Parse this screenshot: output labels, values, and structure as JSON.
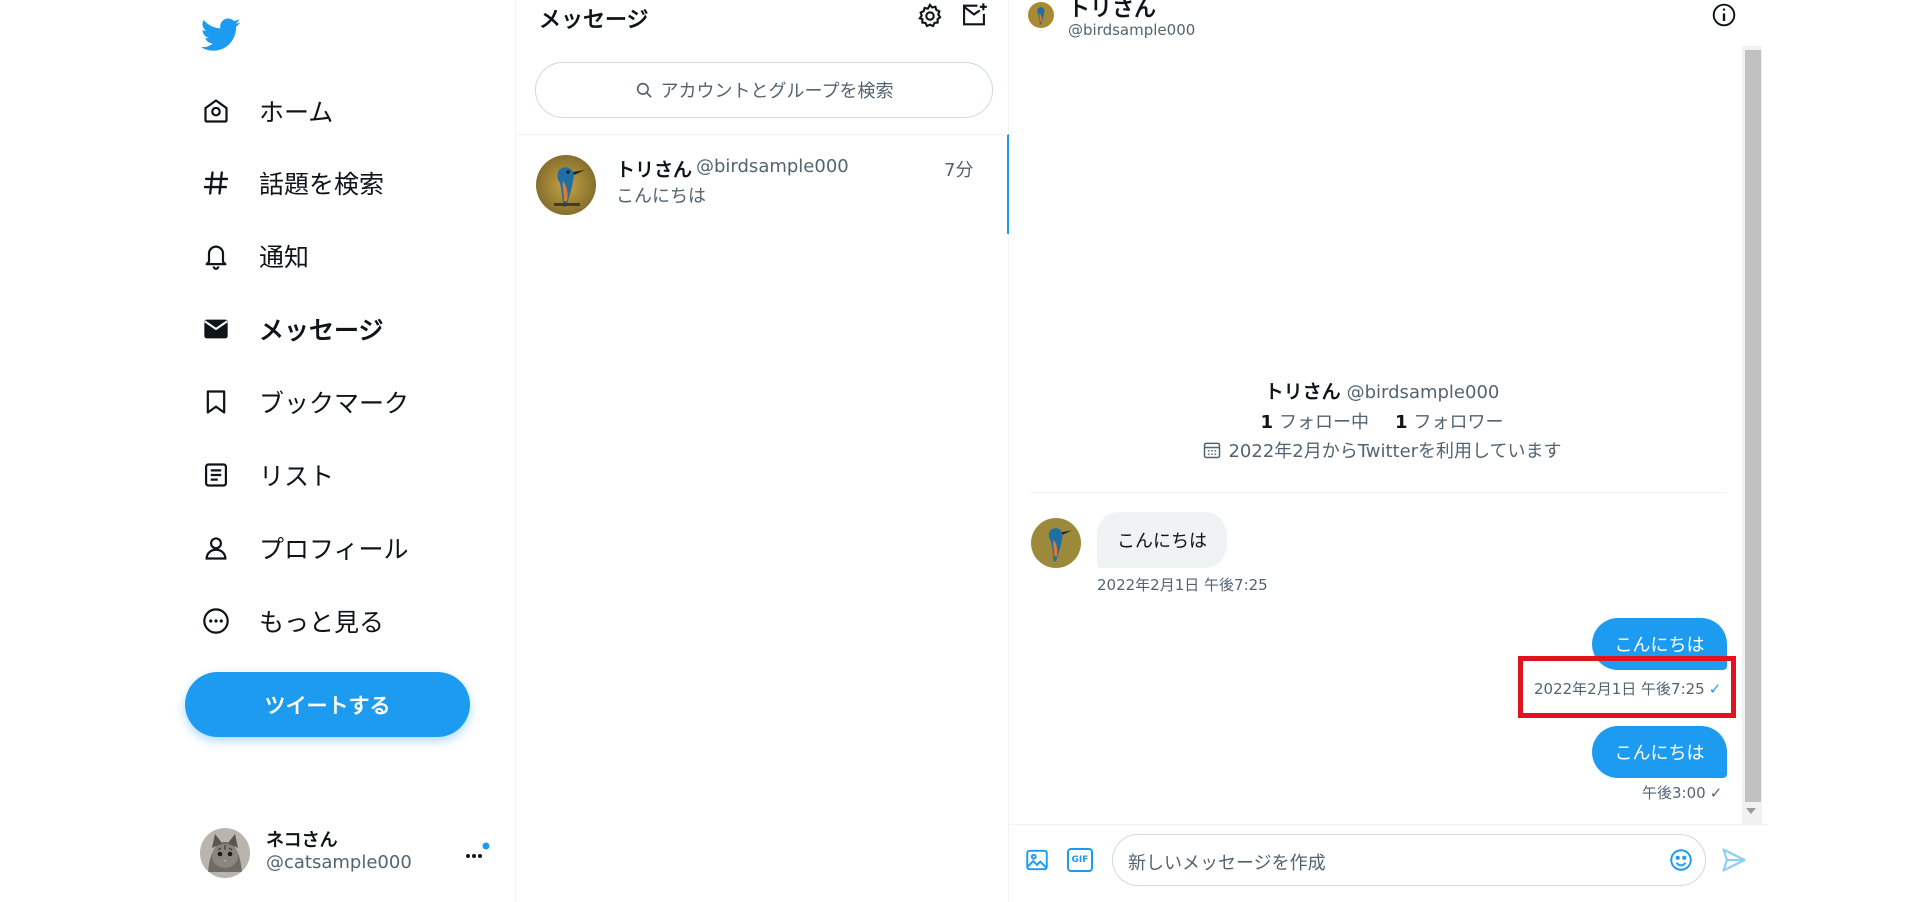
{
  "nav": {
    "items": [
      {
        "label": "ホーム",
        "icon": "home-icon"
      },
      {
        "label": "話題を検索",
        "icon": "hashtag-icon"
      },
      {
        "label": "通知",
        "icon": "bell-icon"
      },
      {
        "label": "メッセージ",
        "icon": "envelope-icon",
        "active": true
      },
      {
        "label": "ブックマーク",
        "icon": "bookmark-icon"
      },
      {
        "label": "リスト",
        "icon": "list-icon"
      },
      {
        "label": "プロフィール",
        "icon": "person-icon"
      },
      {
        "label": "もっと見る",
        "icon": "more-circle-icon"
      }
    ],
    "tweet_button": "ツイートする",
    "account": {
      "name": "ネコさん",
      "handle": "@catsample000"
    }
  },
  "conversations": {
    "title": "メッセージ",
    "search_placeholder": "アカウントとグループを検索",
    "items": [
      {
        "name": "トリさん",
        "handle": "@birdsample000",
        "time": "7分",
        "preview": "こんにちは"
      }
    ]
  },
  "chat": {
    "header": {
      "name": "トリさん",
      "handle": "@birdsample000"
    },
    "profile": {
      "name": "トリさん",
      "handle": "@birdsample000",
      "following_count": "1",
      "following_label": "フォロー中",
      "followers_count": "1",
      "followers_label": "フォロワー",
      "joined": "2022年2月からTwitterを利用しています"
    },
    "messages": [
      {
        "direction": "in",
        "text": "こんにちは",
        "time": "2022年2月1日 午後7:25"
      },
      {
        "direction": "out",
        "text": "こんにちは",
        "time": "2022年2月1日 午後7:25",
        "status": "✓"
      },
      {
        "direction": "out",
        "text": "こんにちは",
        "time": "午後3:00",
        "status": "✓"
      }
    ],
    "composer_placeholder": "新しいメッセージを作成",
    "gif_label": "GIF"
  },
  "colors": {
    "accent": "#1d9bf0",
    "highlight": "#e0141e",
    "text_primary": "#0f1419",
    "text_secondary": "#536471",
    "border": "#eff3f4"
  }
}
